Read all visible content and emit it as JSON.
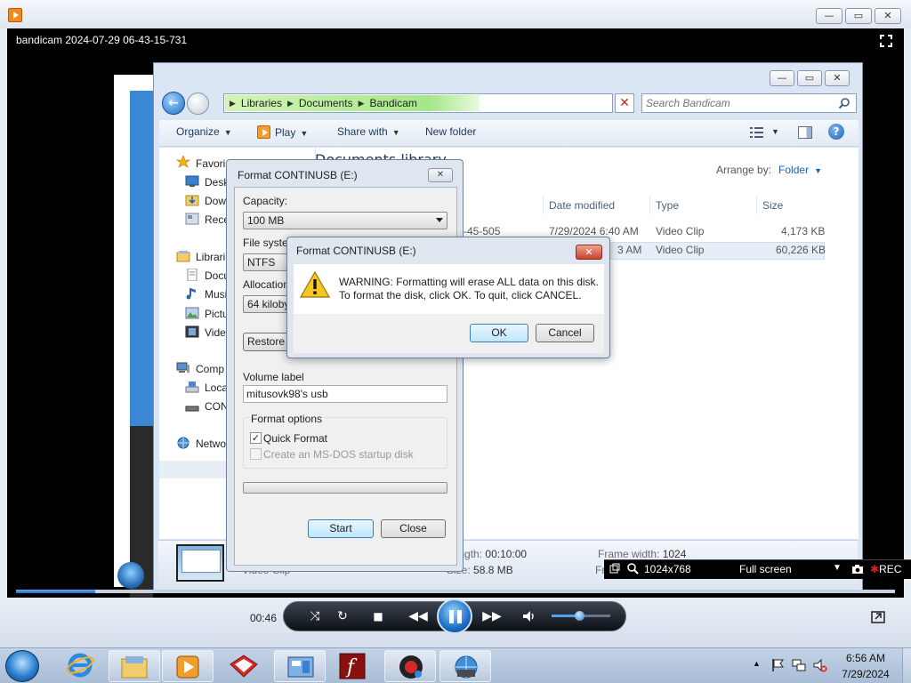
{
  "player": {
    "video_title": "bandicam 2024-07-29 06-43-15-731",
    "time_elapsed": "00:46",
    "progress_fraction": 0.09,
    "volume_fraction": 0.45
  },
  "explorer": {
    "breadcrumbs": [
      "Libraries",
      "Documents",
      "Bandicam"
    ],
    "search_placeholder": "Search Bandicam",
    "toolbar": {
      "organize": "Organize",
      "play": "Play",
      "share_with": "Share with",
      "new_folder": "New folder"
    },
    "nav": {
      "favorites": "Favori",
      "desktop": "Desk",
      "downloads": "Dow",
      "recent": "Rece",
      "libraries": "Librari",
      "documents": "Docu",
      "music": "Musi",
      "pictures": "Pictu",
      "videos": "Vide",
      "computer": "Comp",
      "local_disk": "Loca",
      "usb_drive": "CON",
      "network": "Netwo"
    },
    "library_title": "Documents library",
    "arrange_by_label": "Arrange by:",
    "arrange_by_value": "Folder",
    "columns": {
      "date": "Date modified",
      "type": "Type",
      "size": "Size"
    },
    "files": [
      {
        "name_fragment": "-45-505",
        "date": "7/29/2024 6:40 AM",
        "type": "Video Clip",
        "size": "4,173 KB"
      },
      {
        "name_fragment": "",
        "date": "3 AM",
        "type": "Video Clip",
        "size": "60,226 KB"
      }
    ],
    "details": {
      "type_fragment": "Video Clip",
      "length_label": "Length:",
      "length_value": "00:10:00",
      "size_label": "Size:",
      "size_value": "58.8 MB",
      "frame_width_label": "Frame width:",
      "frame_width_value": "1024",
      "frame_fragment": "Fr"
    }
  },
  "format_dialog": {
    "title": "Format CONTINUSB (E:)",
    "capacity_label": "Capacity:",
    "capacity_value": "100 MB",
    "filesystem_label": "File system",
    "filesystem_value": "NTFS",
    "allocation_label": "Allocation",
    "allocation_value": "64 kiloby",
    "restore_button": "Restore",
    "volume_label_label": "Volume label",
    "volume_label_value": "mitusovk98's usb",
    "format_options_label": "Format options",
    "quick_format_label": "Quick Format",
    "quick_format_checked": "✓",
    "msdos_label": "Create an MS-DOS startup disk",
    "start_button": "Start",
    "close_button": "Close",
    "close_icon": "✕"
  },
  "warning_dialog": {
    "title": "Format CONTINUSB (E:)",
    "message_line1": "WARNING: Formatting will erase ALL data on this disk.",
    "message_line2": "To format the disk, click OK. To quit, click CANCEL.",
    "ok_button": "OK",
    "cancel_button": "Cancel",
    "close_icon": "✕"
  },
  "bandicam": {
    "resolution": "1024x768",
    "mode": "Full screen",
    "rec": "REC"
  },
  "taskbar": {
    "time": "6:56 AM",
    "date": "7/29/2024"
  },
  "colors": {
    "accent": "#1f6fc4",
    "rec_red": "#e21b1b",
    "close_red": "#c9422d"
  }
}
